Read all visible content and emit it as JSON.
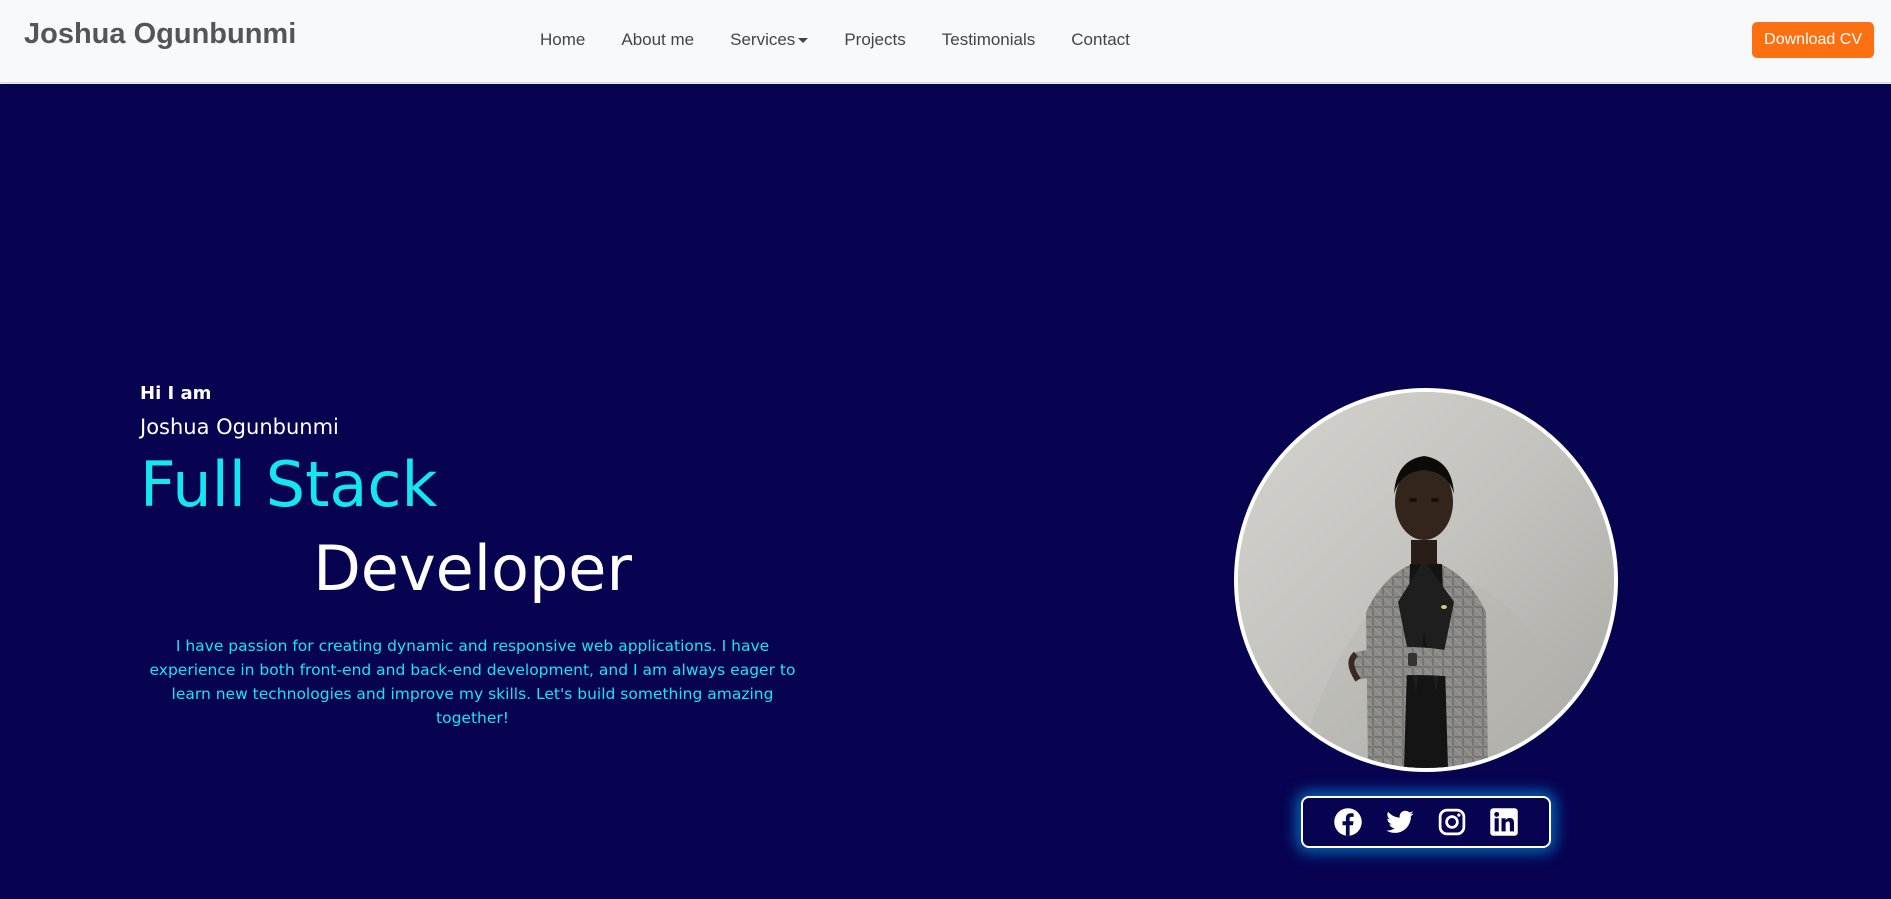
{
  "navbar": {
    "brand": "Joshua Ogunbunmi",
    "links": [
      {
        "label": "Home"
      },
      {
        "label": "About me"
      },
      {
        "label": "Services"
      },
      {
        "label": "Projects"
      },
      {
        "label": "Testimonials"
      },
      {
        "label": "Contact"
      }
    ],
    "cv_button": "Download CV"
  },
  "hero": {
    "greeting": "Hi I am",
    "name": "Joshua Ogunbunmi",
    "role_line1": "Full Stack",
    "role_line2": "Developer",
    "bio": "I have passion for creating dynamic and responsive web applications. I have experience in both front-end and back-end development, and I am always eager to learn new technologies and improve my skills. Let's build something amazing together!"
  },
  "social": {
    "icons": [
      "facebook-icon",
      "twitter-icon",
      "instagram-icon",
      "linkedin-icon"
    ]
  },
  "colors": {
    "hero_bg": "#070351",
    "accent_cyan": "#14e6f2",
    "cv_button": "#fd7012",
    "navbar_bg": "#f8f9fa"
  }
}
